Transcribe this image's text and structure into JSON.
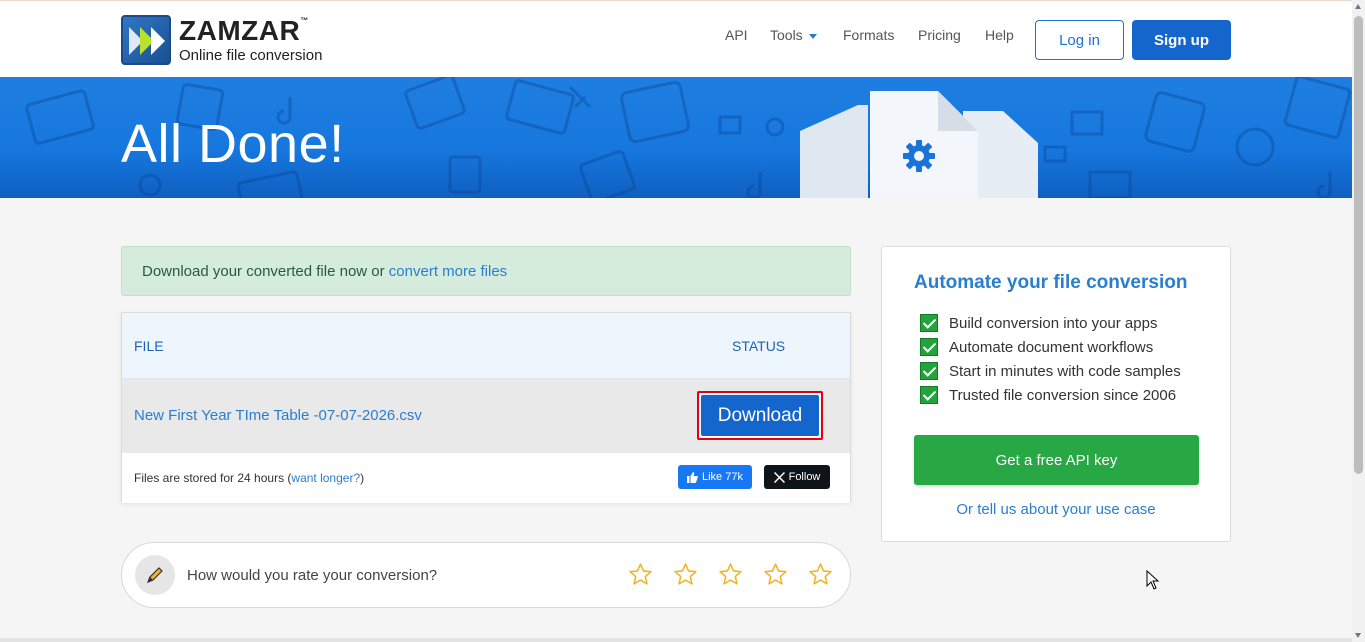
{
  "header": {
    "brand_name": "ZAMZAR",
    "brand_trademark": "™",
    "brand_tagline": "Online file conversion",
    "nav": [
      {
        "label": "API"
      },
      {
        "label": "Tools"
      },
      {
        "label": "Formats"
      },
      {
        "label": "Pricing"
      },
      {
        "label": "Help"
      }
    ],
    "login_label": "Log in",
    "signup_label": "Sign up"
  },
  "banner": {
    "title": "All Done!"
  },
  "alert": {
    "text": "Download your converted file now or ",
    "link": "convert more files"
  },
  "file_table": {
    "col_file": "FILE",
    "col_status": "STATUS",
    "file_name": "New First Year TIme Table -07-07-2026.csv",
    "download_label": "Download",
    "stored_prefix": "Files are stored for 24 hours (",
    "stored_link": "want longer?",
    "stored_suffix": ")",
    "like_label": "Like 77k",
    "follow_label": "Follow"
  },
  "rating": {
    "question": "How would you rate your conversion?",
    "stars": 5
  },
  "api_card": {
    "title": "Automate your file conversion",
    "features": [
      "Build conversion into your apps",
      "Automate document workflows",
      "Start in minutes with code samples",
      "Trusted file conversion since 2006"
    ],
    "cta_label": "Get a free API key",
    "link_label": "Or tell us about your use case"
  },
  "colors": {
    "primary_blue": "#1466cc",
    "link_blue": "#2a7ed0",
    "cta_green": "#28a745",
    "alert_bg": "#d5ecdc",
    "highlight_red": "#e0001b",
    "star_color": "#f0b429"
  }
}
